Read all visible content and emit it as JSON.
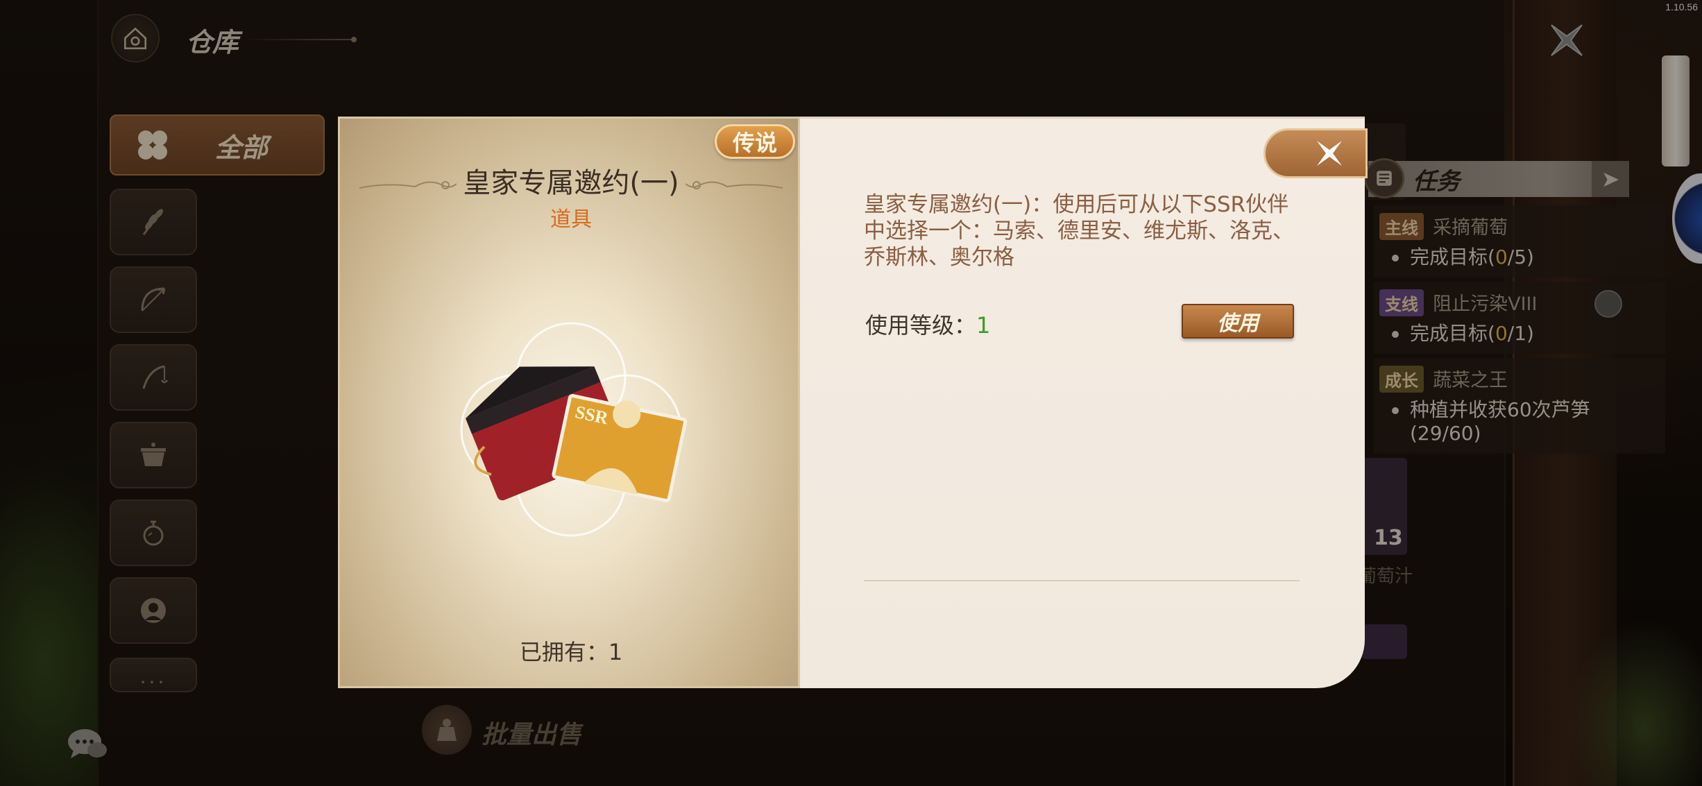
{
  "version": "1.10.56",
  "header": {
    "title": "仓库"
  },
  "sidebar": {
    "all_label": "全部",
    "categories": [
      {
        "icon": "wheat-icon"
      },
      {
        "icon": "bow-icon"
      },
      {
        "icon": "fishing-rod-icon"
      },
      {
        "icon": "cooking-pot-icon"
      },
      {
        "icon": "potion-icon"
      },
      {
        "icon": "portrait-icon"
      },
      {
        "icon": "more-icon",
        "label": "..."
      }
    ]
  },
  "bulk_sell": {
    "label": "批量出售"
  },
  "quest_panel": {
    "title": "任务",
    "items": [
      {
        "tag": "主线",
        "name": "采摘葡萄",
        "goal_prefix": "完成目标(",
        "goal_progress": "0",
        "goal_suffix": "/5)"
      },
      {
        "tag": "支线",
        "name": "阻止污染VIII",
        "goal_prefix": "完成目标(",
        "goal_progress": "0",
        "goal_suffix": "/1)"
      },
      {
        "tag": "成长",
        "name": "蔬菜之王",
        "goal_text": "种植并收获60次芦笋(29/60)"
      }
    ],
    "count_badge": "13",
    "juice_label": "葡萄汁"
  },
  "item_dialog": {
    "rarity": "传说",
    "name": "皇家专属邀约(一)",
    "type": "道具",
    "owned_label": "已拥有：",
    "owned_count": "1",
    "description": "皇家专属邀约(一)：使用后可从以下SSR伙伴中选择一个：马索、德里安、维尤斯、洛克、乔斯林、奥尔格",
    "level_label": "使用等级：",
    "level_value": "1",
    "use_label": "使用",
    "card_badge": "SSR"
  },
  "colors": {
    "rarity_orange": "#d86a1e",
    "level_green": "#3a9a2a",
    "button_brown": "#9a5a28",
    "description_brown": "#8a5e42"
  }
}
